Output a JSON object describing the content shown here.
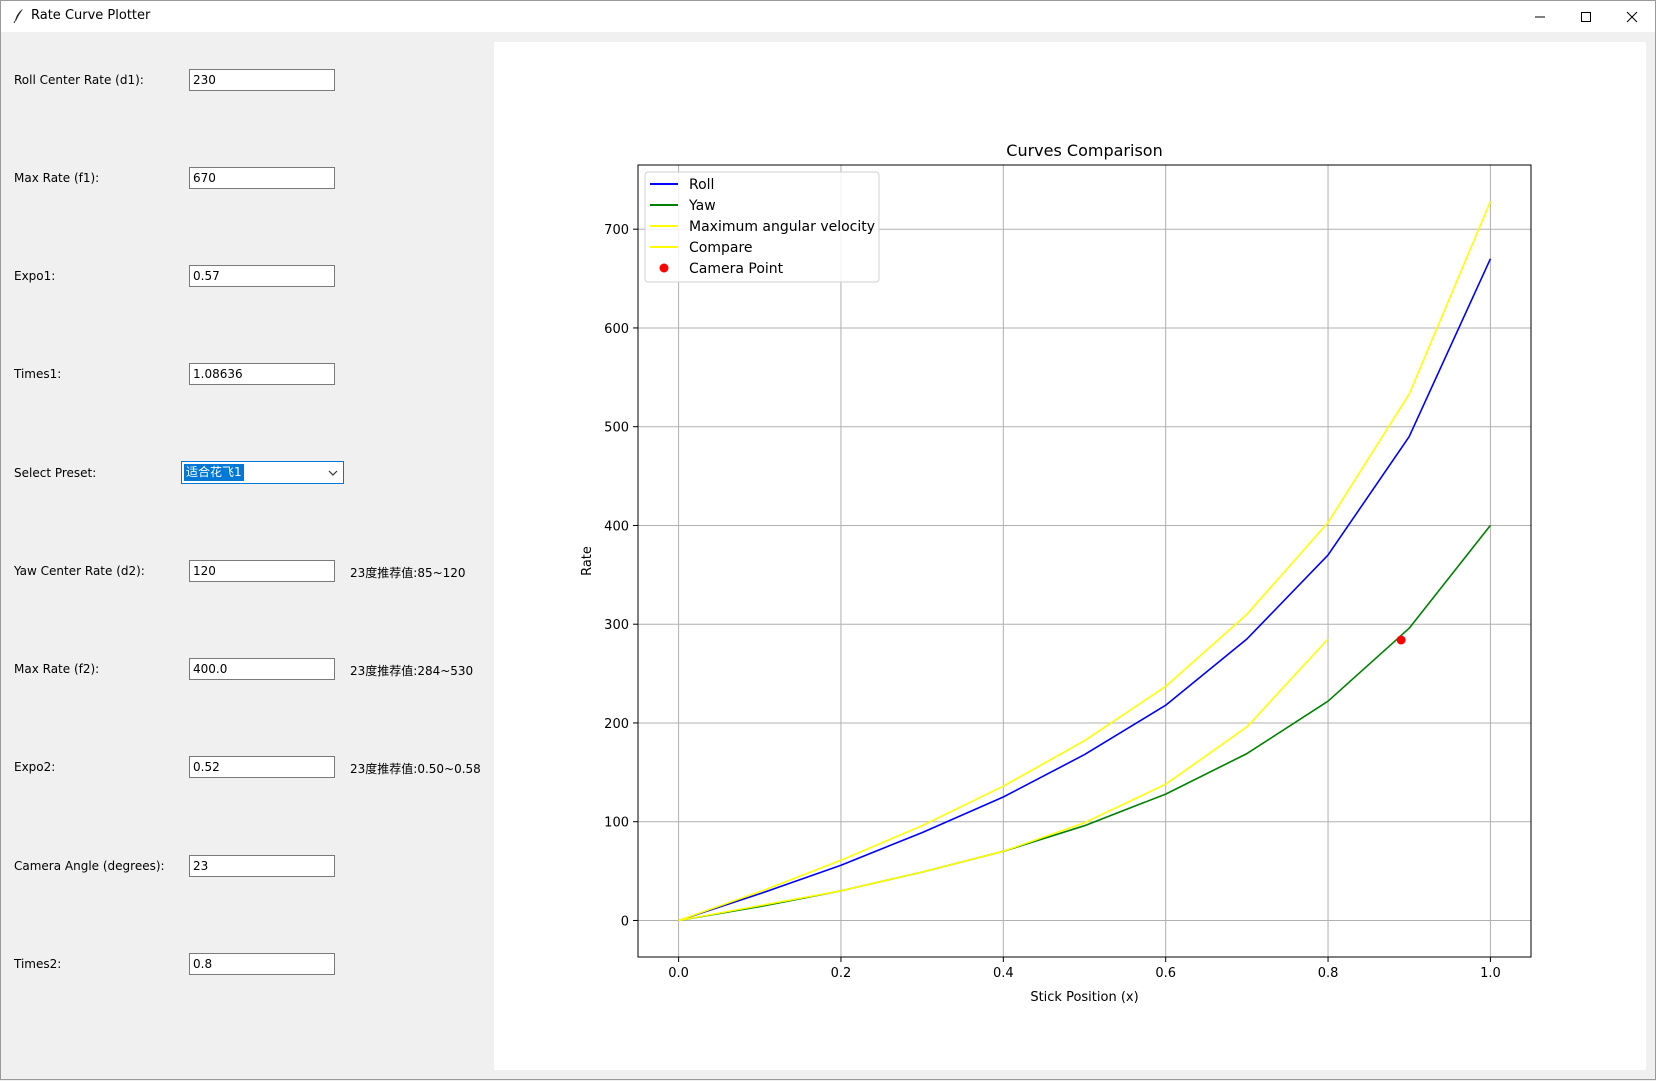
{
  "window": {
    "title": "Rate Curve Plotter",
    "controls": {
      "minimize_icon": "minimize-icon",
      "maximize_icon": "maximize-icon",
      "close_icon": "close-icon"
    }
  },
  "form": {
    "roll_center_rate": {
      "label": "Roll Center Rate (d1):",
      "value": "230"
    },
    "max_rate_f1": {
      "label": "Max Rate (f1):",
      "value": "670"
    },
    "expo1": {
      "label": "Expo1:",
      "value": "0.57"
    },
    "times1": {
      "label": "Times1:",
      "value": "1.08636"
    },
    "preset": {
      "label": "Select Preset:",
      "value": "适合花飞1"
    },
    "yaw_center_rate": {
      "label": "Yaw Center Rate (d2):",
      "value": "120",
      "hint": "23度推荐值:85~120"
    },
    "max_rate_f2": {
      "label": "Max Rate (f2):",
      "value": "400.0",
      "hint": "23度推荐值:284~530"
    },
    "expo2": {
      "label": "Expo2:",
      "value": "0.52",
      "hint": "23度推荐值:0.50~0.58"
    },
    "camera_angle": {
      "label": "Camera Angle (degrees):",
      "value": "23"
    },
    "times2": {
      "label": "Times2:",
      "value": "0.8"
    }
  },
  "chart_data": {
    "type": "line",
    "title": "Curves Comparison",
    "xlabel": "Stick Position (x)",
    "ylabel": "Rate",
    "xlim": [
      -0.05,
      1.05
    ],
    "ylim": [
      -37,
      765
    ],
    "xticks": [
      0.0,
      0.2,
      0.4,
      0.6,
      0.8,
      1.0
    ],
    "xtick_labels": [
      "0.0",
      "0.2",
      "0.4",
      "0.6",
      "0.8",
      "1.0"
    ],
    "yticks": [
      0,
      100,
      200,
      300,
      400,
      500,
      600,
      700
    ],
    "ytick_labels": [
      "0",
      "100",
      "200",
      "300",
      "400",
      "500",
      "600",
      "700"
    ],
    "grid": true,
    "legend_position": "top-left",
    "series": [
      {
        "name": "Roll",
        "color": "#0000ff",
        "kind": "line",
        "x": [
          0.0,
          0.1,
          0.2,
          0.3,
          0.4,
          0.5,
          0.6,
          0.7,
          0.8,
          0.9,
          1.0
        ],
        "y": [
          0,
          27,
          56,
          89,
          125,
          168,
          218,
          285,
          370,
          490,
          670
        ]
      },
      {
        "name": "Yaw",
        "color": "#008000",
        "kind": "line",
        "x": [
          0.0,
          0.1,
          0.2,
          0.3,
          0.4,
          0.5,
          0.6,
          0.7,
          0.8,
          0.9,
          1.0
        ],
        "y": [
          0,
          14,
          30,
          49,
          70,
          96,
          128,
          169,
          222,
          296,
          400
        ]
      },
      {
        "name": "Maximum angular velocity",
        "color": "#ffff00",
        "kind": "line",
        "x": [
          0.0,
          0.1,
          0.2,
          0.3,
          0.4,
          0.5,
          0.6,
          0.7,
          0.8,
          0.9,
          1.0
        ],
        "y": [
          0,
          29,
          61,
          96,
          136,
          182,
          237,
          310,
          403,
          533,
          728
        ]
      },
      {
        "name": "Compare",
        "color": "#ffff00",
        "kind": "line",
        "x": [
          0.0,
          0.1,
          0.2,
          0.3,
          0.4,
          0.5,
          0.6,
          0.7,
          0.8
        ],
        "y": [
          0,
          15,
          30,
          49,
          70,
          99,
          138,
          196,
          285
        ]
      },
      {
        "name": "Camera Point",
        "color": "#ff0000",
        "kind": "point",
        "x": [
          0.89
        ],
        "y": [
          284
        ]
      }
    ]
  }
}
